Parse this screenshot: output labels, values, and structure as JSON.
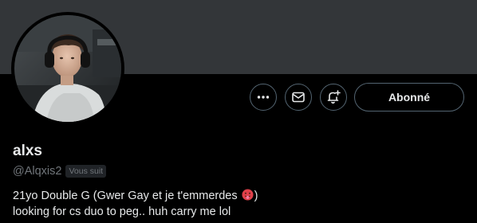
{
  "banner": {
    "color": "#333639"
  },
  "avatar": {
    "icon": "profile-photo-avatar"
  },
  "actions": {
    "more_icon": "ellipsis-icon",
    "message_icon": "envelope-icon",
    "notify_icon": "bell-plus-icon",
    "follow_label": "Abonné"
  },
  "profile": {
    "display_name": "alxs",
    "handle": "@Alqxis2",
    "follows_you_badge": "Vous suit",
    "bio_line1_text": "21yo Double G (Gwer Gay et je t'emmerdes",
    "bio_line1_emoji": "tongue-out-emoji",
    "bio_line1_end": ")",
    "bio_line2": "looking for cs duo to peg.. huh carry me lol"
  },
  "colors": {
    "background": "#000000",
    "text_primary": "#e7e9ea",
    "text_secondary": "#71767b",
    "border": "#536471",
    "badge_bg": "#202327"
  }
}
